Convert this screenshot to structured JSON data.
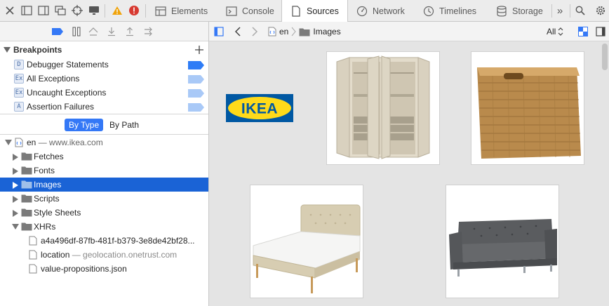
{
  "tabs": [
    {
      "label": "Elements",
      "icon": "elements-icon"
    },
    {
      "label": "Console",
      "icon": "console-icon"
    },
    {
      "label": "Sources",
      "icon": "sources-icon",
      "active": true
    },
    {
      "label": "Network",
      "icon": "network-icon"
    },
    {
      "label": "Timelines",
      "icon": "timelines-icon"
    },
    {
      "label": "Storage",
      "icon": "storage-icon"
    }
  ],
  "overflow_label": "»",
  "breakpoints": {
    "title": "Breakpoints",
    "items": [
      {
        "badge": "D",
        "label": "Debugger Statements",
        "enabled": true
      },
      {
        "badge": "Ex",
        "label": "All Exceptions",
        "enabled": false
      },
      {
        "badge": "Ex",
        "label": "Uncaught Exceptions",
        "enabled": false
      },
      {
        "badge": "A",
        "label": "Assertion Failures",
        "enabled": false
      }
    ]
  },
  "filter": {
    "by_type": "By Type",
    "by_path": "By Path"
  },
  "tree": {
    "root": {
      "name": "en",
      "host": "— www.ikea.com"
    },
    "folders": [
      {
        "label": "Fetches",
        "expanded": false,
        "selected": false
      },
      {
        "label": "Fonts",
        "expanded": false,
        "selected": false
      },
      {
        "label": "Images",
        "expanded": false,
        "selected": true
      },
      {
        "label": "Scripts",
        "expanded": false,
        "selected": false
      },
      {
        "label": "Style Sheets",
        "expanded": false,
        "selected": false
      },
      {
        "label": "XHRs",
        "expanded": true,
        "selected": false
      }
    ],
    "xhr_files": [
      {
        "name": "a4a496df-87fb-481f-b379-3e8de42bf28...",
        "host": ""
      },
      {
        "name": "location",
        "host": "— geolocation.onetrust.com"
      },
      {
        "name": "value-propositions.json",
        "host": ""
      }
    ]
  },
  "breadcrumb": {
    "root": "en",
    "folder": "Images"
  },
  "zoom": {
    "label": "All"
  },
  "logo_text": "IKEA",
  "colors": {
    "accent": "#3478f6",
    "selected_row": "#1a63d6",
    "breakpoint_on": "#2e7cf6",
    "breakpoint_off": "#a9c9f7",
    "ikea_blue": "#0058a3",
    "ikea_yellow": "#ffda1a",
    "warning": "#f0a30a",
    "error": "#d73a31"
  }
}
